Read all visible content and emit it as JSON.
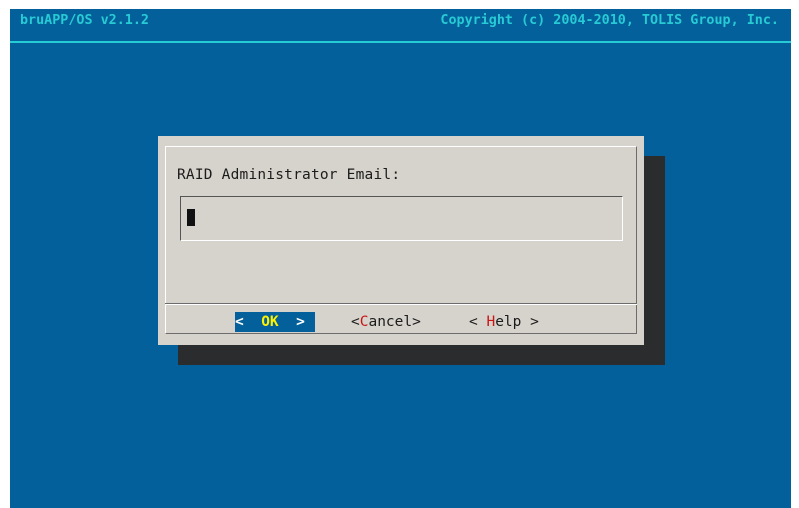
{
  "backtitle": {
    "product": "bruAPP/OS v2.1.2",
    "copyright": "Copyright (c) 2004-2010, TOLIS Group, Inc."
  },
  "dialog": {
    "prompt": "RAID Administrator Email:",
    "input_value": "",
    "buttons": {
      "ok": {
        "left": "<  ",
        "hot": "OK",
        "right": "  >"
      },
      "cancel": {
        "left": "<",
        "hot": "C",
        "right": "ancel>"
      },
      "help": {
        "left": "< ",
        "hot": "H",
        "right": "elp >"
      }
    }
  },
  "colors": {
    "background": "#03609a",
    "title_text": "#27cbd5",
    "dialog": "#d6d3cc",
    "shadow": "#2a2c2e",
    "hotkey": "#c81414",
    "active_hotkey": "#fff200"
  }
}
